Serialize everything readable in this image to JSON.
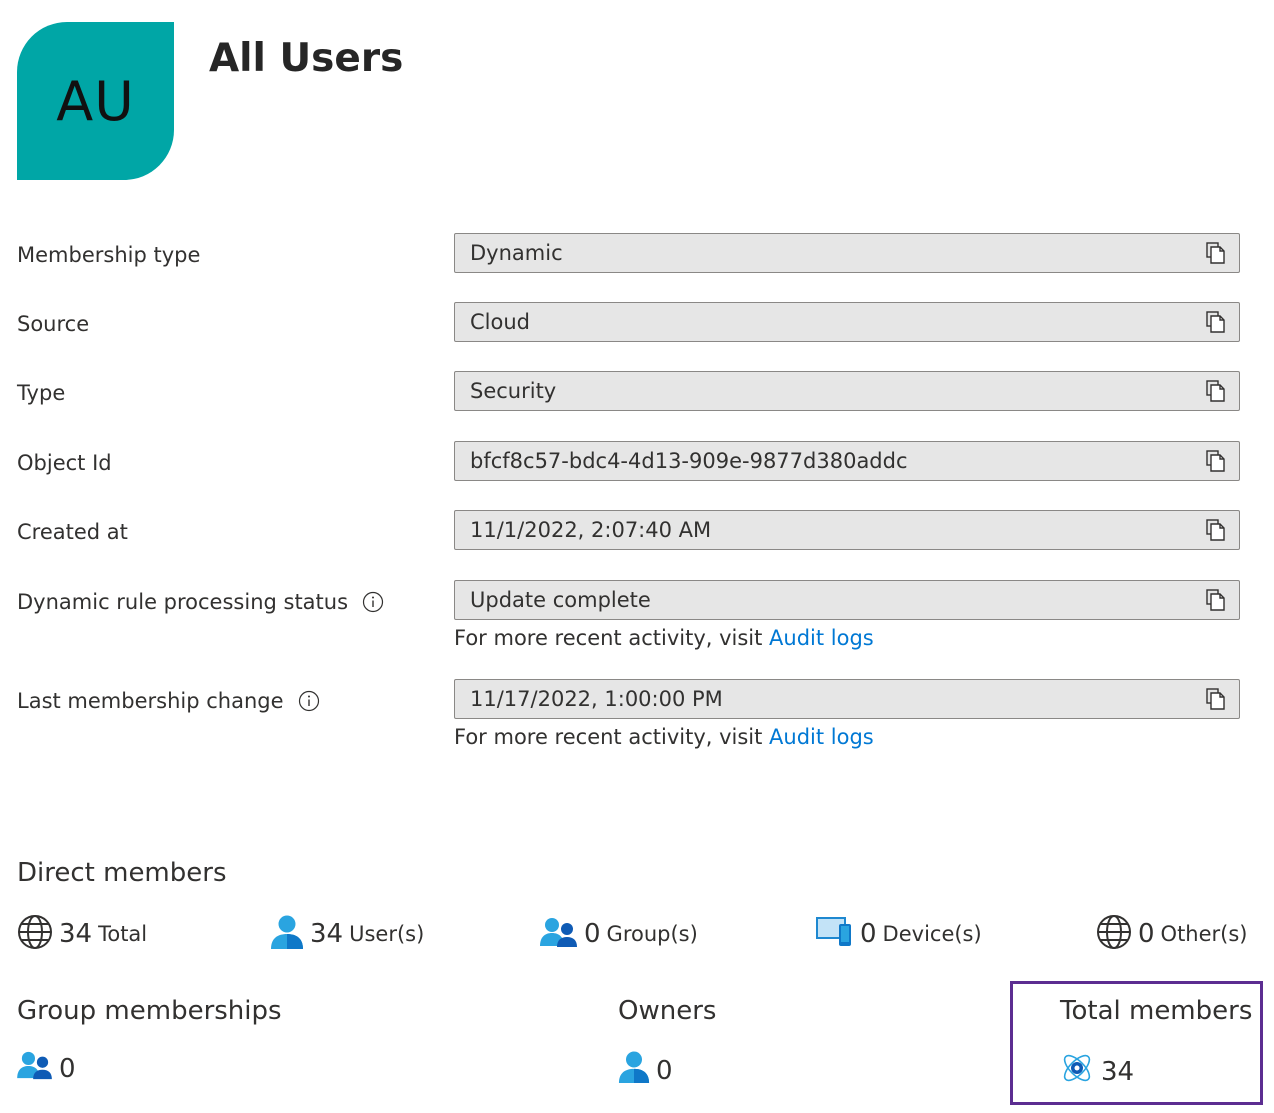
{
  "group": {
    "initials": "AU",
    "name": "All Users"
  },
  "properties": [
    {
      "label": "Membership type",
      "value": "Dynamic"
    },
    {
      "label": "Source",
      "value": "Cloud"
    },
    {
      "label": "Type",
      "value": "Security"
    },
    {
      "label": "Object Id",
      "value": "bfcf8c57-bdc4-4d13-909e-9877d380addc"
    },
    {
      "label": "Created at",
      "value": "11/1/2022, 2:07:40 AM"
    },
    {
      "label": "Dynamic rule processing status",
      "value": "Update complete",
      "hint_text": "For more recent activity, visit ",
      "hint_link": "Audit logs"
    },
    {
      "label": "Last membership change",
      "value": "11/17/2022, 1:00:00 PM",
      "hint_text": "For more recent activity, visit ",
      "hint_link": "Audit logs"
    }
  ],
  "direct_members": {
    "heading": "Direct members",
    "total": {
      "count": "34",
      "unit": "Total"
    },
    "users": {
      "count": "34",
      "unit": "User(s)"
    },
    "groups": {
      "count": "0",
      "unit": "Group(s)"
    },
    "devices": {
      "count": "0",
      "unit": "Device(s)"
    },
    "others": {
      "count": "0",
      "unit": "Other(s)"
    }
  },
  "group_memberships": {
    "heading": "Group memberships",
    "count": "0"
  },
  "owners": {
    "heading": "Owners",
    "count": "0"
  },
  "total_members": {
    "heading": "Total members",
    "count": "34"
  },
  "colors": {
    "avatar_bg": "#00a6a6",
    "link": "#0078d4",
    "highlight_border": "#5c2d91",
    "field_bg": "#e6e6e6"
  }
}
